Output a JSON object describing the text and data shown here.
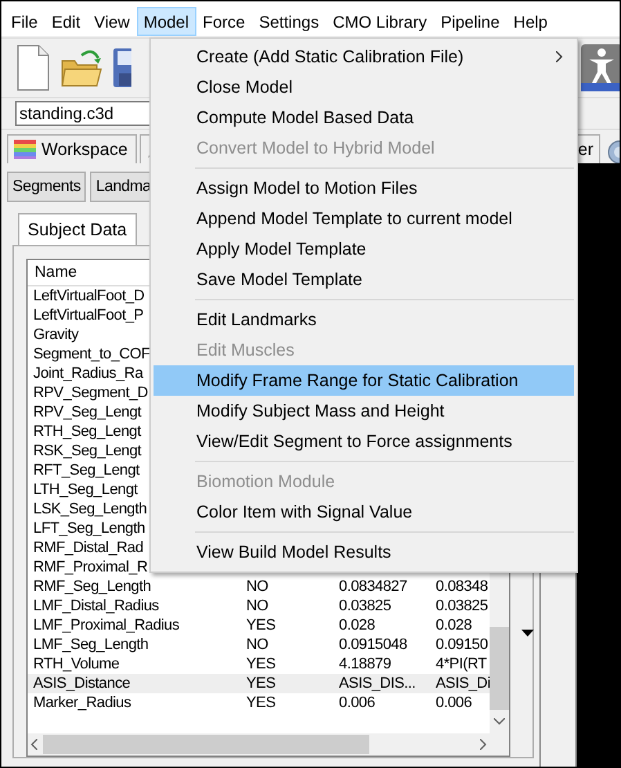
{
  "menubar": [
    {
      "label": "File",
      "selected": false
    },
    {
      "label": "Edit",
      "selected": false
    },
    {
      "label": "View",
      "selected": false
    },
    {
      "label": "Model",
      "selected": true
    },
    {
      "label": "Force",
      "selected": false
    },
    {
      "label": "Settings",
      "selected": false
    },
    {
      "label": "CMO Library",
      "selected": false
    },
    {
      "label": "Pipeline",
      "selected": false
    },
    {
      "label": "Help",
      "selected": false
    }
  ],
  "file_field": {
    "value": "standing.c3d"
  },
  "tabs": [
    {
      "label": "Workspace"
    },
    {
      "label": "er"
    }
  ],
  "panel_buttons": [
    "Segments",
    "Landma"
  ],
  "subtab": {
    "label": "Subject Data"
  },
  "table": {
    "columns": [
      "Name"
    ],
    "rows": [
      {
        "name": "LeftVirtualFoot_D",
        "selected": false
      },
      {
        "name": "LeftVirtualFoot_P",
        "selected": false
      },
      {
        "name": "Gravity",
        "selected": false
      },
      {
        "name": "Segment_to_COF",
        "selected": false
      },
      {
        "name": "Joint_Radius_Ra",
        "selected": false
      },
      {
        "name": "RPV_Segment_D",
        "selected": false
      },
      {
        "name": "RPV_Seg_Lengt",
        "selected": false
      },
      {
        "name": "RTH_Seg_Lengt",
        "selected": false
      },
      {
        "name": "RSK_Seg_Lengt",
        "selected": false
      },
      {
        "name": "RFT_Seg_Lengt",
        "selected": false
      },
      {
        "name": "LTH_Seg_Lengt",
        "selected": false
      },
      {
        "name": "LSK_Seg_Length",
        "selected": false
      },
      {
        "name": "LFT_Seg_Length",
        "selected": false
      },
      {
        "name": "RMF_Distal_Rad",
        "selected": false
      },
      {
        "name": "RMF_Proximal_R",
        "selected": false
      },
      {
        "name": "RMF_Seg_Length",
        "column_2": "NO",
        "column_3": "0.0834827",
        "column_4": "0.08348",
        "selected": false
      },
      {
        "name": "LMF_Distal_Radius",
        "column_2": "NO",
        "column_3": "0.03825",
        "column_4": "0.03825",
        "selected": false
      },
      {
        "name": "LMF_Proximal_Radius",
        "column_2": "YES",
        "column_3": "0.028",
        "column_4": "0.028",
        "selected": false
      },
      {
        "name": "LMF_Seg_Length",
        "column_2": "NO",
        "column_3": "0.0915048",
        "column_4": "0.09150",
        "selected": false
      },
      {
        "name": "RTH_Volume",
        "column_2": "YES",
        "column_3": "4.18879",
        "column_4": "4*PI(RT",
        "selected": false
      },
      {
        "name": "ASIS_Distance",
        "column_2": "YES",
        "column_3": "ASIS_DIS...",
        "column_4": "ASIS_Di",
        "selected": true
      },
      {
        "name": "Marker_Radius",
        "column_2": "YES",
        "column_3": "0.006",
        "column_4": "0.006",
        "selected": false
      }
    ]
  },
  "menu": {
    "items": [
      {
        "kind": "item",
        "label": "Create (Add Static Calibration File)",
        "disabled": false,
        "selected": false,
        "submenu": true
      },
      {
        "kind": "item",
        "label": "Close Model",
        "disabled": false,
        "selected": false,
        "submenu": false
      },
      {
        "kind": "item",
        "label": "Compute Model Based Data",
        "disabled": false,
        "selected": false,
        "submenu": false
      },
      {
        "kind": "item",
        "label": "Convert Model to Hybrid Model",
        "disabled": true,
        "selected": false,
        "submenu": false
      },
      {
        "kind": "separator"
      },
      {
        "kind": "item",
        "label": "Assign Model to Motion Files",
        "disabled": false,
        "selected": false,
        "submenu": false
      },
      {
        "kind": "item",
        "label": "Append Model Template to current model",
        "disabled": false,
        "selected": false,
        "submenu": false
      },
      {
        "kind": "item",
        "label": "Apply Model Template",
        "disabled": false,
        "selected": false,
        "submenu": false
      },
      {
        "kind": "item",
        "label": "Save Model Template",
        "disabled": false,
        "selected": false,
        "submenu": false
      },
      {
        "kind": "separator"
      },
      {
        "kind": "item",
        "label": "Edit Landmarks",
        "disabled": false,
        "selected": false,
        "submenu": false
      },
      {
        "kind": "item",
        "label": "Edit Muscles",
        "disabled": true,
        "selected": false,
        "submenu": false
      },
      {
        "kind": "item",
        "label": "Modify Frame Range for Static Calibration",
        "disabled": false,
        "selected": true,
        "submenu": false
      },
      {
        "kind": "item",
        "label": "Modify Subject Mass and Height",
        "disabled": false,
        "selected": false,
        "submenu": false
      },
      {
        "kind": "item",
        "label": "View/Edit Segment to Force assignments",
        "disabled": false,
        "selected": false,
        "submenu": false
      },
      {
        "kind": "separator"
      },
      {
        "kind": "item",
        "label": "Biomotion Module",
        "disabled": true,
        "selected": false,
        "submenu": false
      },
      {
        "kind": "item",
        "label": "Color Item with Signal Value",
        "disabled": false,
        "selected": false,
        "submenu": false
      },
      {
        "kind": "separator"
      },
      {
        "kind": "item",
        "label": "View Build Model Results",
        "disabled": false,
        "selected": false,
        "submenu": false
      }
    ]
  }
}
